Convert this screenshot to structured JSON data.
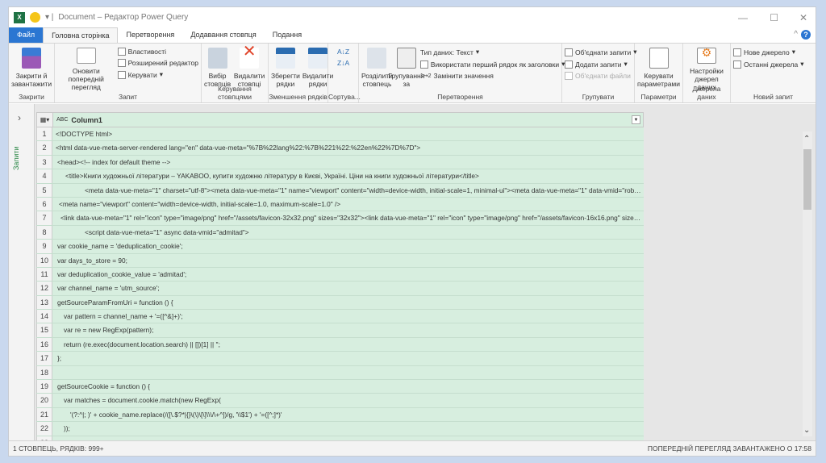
{
  "title": "Document – Редактор Power Query",
  "tabs": [
    "Файл",
    "Головна сторінка",
    "Перетворення",
    "Додавання стовпця",
    "Подання"
  ],
  "ribbon": {
    "close_load": "Закрити й завантажити",
    "group_close": "Закрити",
    "refresh": "Оновити попередній перегляд",
    "properties": "Властивості",
    "advanced": "Розширений редактор",
    "manage": "Керувати",
    "group_query": "Запит",
    "choose_cols": "Вибір стовпців",
    "remove_cols": "Видалити стовпці",
    "group_manage_cols": "Керування стовпцями",
    "keep_rows": "Зберегти рядки",
    "remove_rows": "Видалити рядки",
    "group_reduce": "Зменшення рядків",
    "group_sort": "Сортува...",
    "split": "Розділити стовпець",
    "group_by": "Групування за",
    "data_type": "Тип даних: Текст",
    "first_row": "Використати перший рядок як заголовки",
    "replace": "Замінити значення",
    "group_transform": "Перетворення",
    "merge": "Об'єднати запити",
    "append": "Додати запити",
    "combine": "Об'єднати файли",
    "group_combine": "Групувати",
    "params": "Керувати параметрами",
    "group_params": "Параметри",
    "ds_settings": "Настройки джерел даних",
    "group_ds": "Джерела даних",
    "new_source": "Нове джерело",
    "recent": "Останні джерела",
    "group_new": "Новий запит"
  },
  "queries_label": "Запити",
  "column": {
    "type": "ABC",
    "name": "Column1"
  },
  "rows": [
    "<!DOCTYPE html>",
    "<html data-vue-meta-server-rendered lang=\"en\" data-vue-meta=\"%7B%22lang%22:%7B%221%22:%22en%22%7D%7D\">",
    "<head><!-- index for default theme -->",
    "<title>Книги художньої літератури – YAKABOO, купити художню літературу в Києві, Україні. Ціни на книги художньої літератури</title>",
    "<meta data-vue-meta=\"1\" charset=\"utf-8\"><meta data-vue-meta=\"1\" name=\"viewport\" content=\"width=device-width, initial-scale=1, minimal-ui\"><meta data-vue-meta=\"1\" data-vmid=\"robots\" ...",
    "<meta name=\"viewport\" content=\"width=device-width, initial-scale=1.0, maximum-scale=1.0\" />",
    "<link data-vue-meta=\"1\" rel=\"icon\" type=\"image/png\" href=\"/assets/favicon-32x32.png\" sizes=\"32x32\"><link data-vue-meta=\"1\" rel=\"icon\" type=\"image/png\" href=\"/assets/favicon-16x16.png\" sizes=\"1...",
    "<script data-vue-meta=\"1\" async data-vmid=\"admitad\">",
    "var cookie_name = 'deduplication_cookie';",
    "var days_to_store = 90;",
    "var deduplication_cookie_value = 'admitad';",
    "var channel_name = 'utm_source';",
    "getSourceParamFromUri = function () {",
    "var pattern = channel_name + '=([^&]+)';",
    "var re = new RegExp(pattern);",
    "return (re.exec(document.location.search) || [])[1] || '';",
    "};",
    "",
    "getSourceCookie = function () {",
    "var matches = document.cookie.match(new RegExp(",
    "'(?:^|; )' + cookie_name.replace(/([\\.$?*|{}\\(\\)\\[\\]\\\\\\/\\+^])/g, '\\\\$1') + '=([^;]*)'",
    "));",
    ""
  ],
  "status_left": "1 СТОВПЕЦЬ, РЯДКІВ: 999+",
  "status_right": "ПОПЕРЕДНІЙ ПЕРЕГЛЯД ЗАВАНТАЖЕНО О 17:58"
}
